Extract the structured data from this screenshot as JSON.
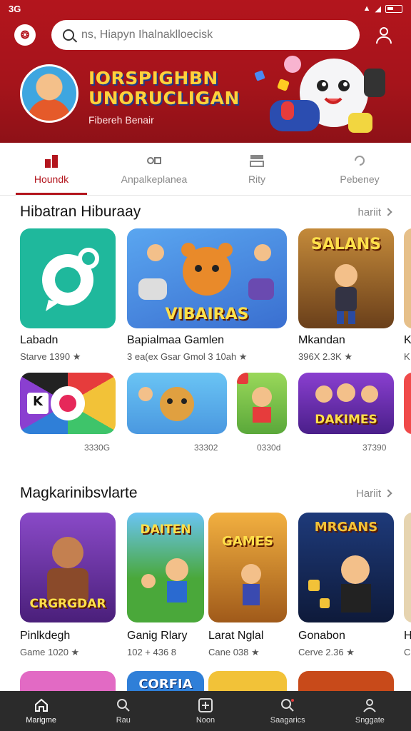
{
  "status": {
    "time": "3G"
  },
  "header": {
    "logo_text": "❂",
    "search_placeholder": "ns, Hiapyn Ihalnaklloecisk",
    "promo_title_line1": "IORSPIGHBN",
    "promo_title_line2": "UNORUCLIGAN",
    "promo_subtitle": "Fibereh Benair"
  },
  "tabs": [
    {
      "label": "Houndk",
      "icon": "grid-icon",
      "active": true
    },
    {
      "label": "Anpalkeplanea",
      "icon": "apps-icon",
      "active": false
    },
    {
      "label": "Rity",
      "icon": "play-icon",
      "active": false
    },
    {
      "label": "Pebeney",
      "icon": "refresh-icon",
      "active": false
    }
  ],
  "section1": {
    "title": "Hibatran Hiburaay",
    "more": "hariit",
    "row1": [
      {
        "name": "Labadn",
        "meta": "Starve 1390 ★",
        "art": "",
        "color": "#1fb89c"
      },
      {
        "name": "Bapialmaa Gamlen",
        "meta": "3 ea(ex Gsar Gmol 3 10ah ★",
        "art": "VIBAIRAS",
        "color": "#3f7fd4"
      },
      {
        "name": "Mkandan",
        "meta": "396X 2.3K ★",
        "art": "SALANS",
        "color": "#8a5a2a"
      },
      {
        "name": "K",
        "meta": "K",
        "art": "",
        "color": "#e6e6e6"
      }
    ],
    "row2": [
      {
        "meta": "3330G",
        "art": "K",
        "color": "#222222"
      },
      {
        "meta": "33302",
        "art": "",
        "color": "#4aa8e8"
      },
      {
        "meta": "0330d",
        "art": "",
        "color": "#7ecb4a"
      },
      {
        "meta": "37390",
        "art": "DAKIMES",
        "color": "#6a2fb8"
      }
    ]
  },
  "section2": {
    "title": "Magkarinibsvlarte",
    "more": "Hariit",
    "row1": [
      {
        "name": "Pinlkdegh",
        "meta": "Game 1020 ★",
        "art": "CRGRGDAR",
        "color": "#7a3fb0"
      },
      {
        "name": "Ganig Rlary",
        "meta": "102 + 436 8",
        "art": "DAITEN",
        "color": "#3e9a3e"
      },
      {
        "name": "Larat Nglal",
        "meta": "Cane 038 ★",
        "art": "GAMES",
        "color": "#c86a28"
      },
      {
        "name": "Gonabon",
        "meta": "Cerve 2.36 ★",
        "art": "MRGANS",
        "color": "#1e3a7a"
      },
      {
        "name": "H",
        "meta": "C",
        "art": "",
        "color": "#e6e6e6"
      }
    ],
    "row2": [
      {
        "art": "",
        "color": "#e26ac4"
      },
      {
        "art": "CORFIA",
        "color": "#2f7fd8"
      },
      {
        "art": "",
        "color": "#f2c238"
      },
      {
        "art": "",
        "color": "#c84a1a"
      }
    ]
  },
  "bottom_nav": [
    {
      "label": "Marigme",
      "icon": "home-icon",
      "active": true
    },
    {
      "label": "Rau",
      "icon": "search-icon",
      "active": false
    },
    {
      "label": "Noon",
      "icon": "add-icon",
      "active": false
    },
    {
      "label": "Saagarics",
      "icon": "search-plus-icon",
      "active": false
    },
    {
      "label": "Snggate",
      "icon": "profile-icon",
      "active": false
    }
  ],
  "colors": {
    "brand": "#b3151d",
    "nav_bg": "#2b2b2b"
  }
}
